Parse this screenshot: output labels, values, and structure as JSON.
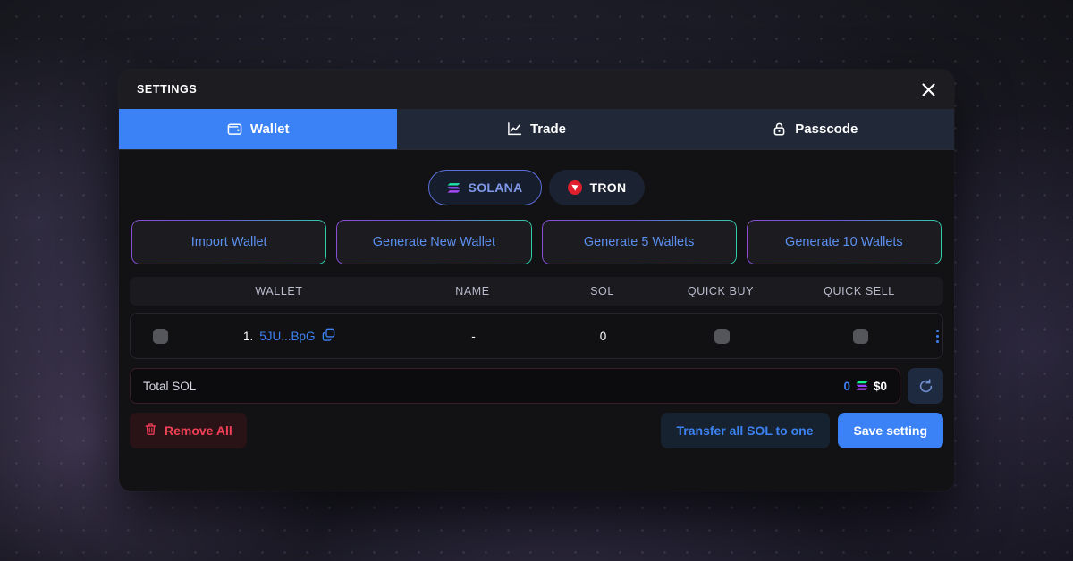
{
  "modal": {
    "title": "SETTINGS",
    "close_icon": "close-icon"
  },
  "tabs": [
    {
      "label": "Wallet",
      "icon": "wallet-icon",
      "active": true
    },
    {
      "label": "Trade",
      "icon": "line-chart-icon",
      "active": false
    },
    {
      "label": "Passcode",
      "icon": "lock-icon",
      "active": false
    }
  ],
  "chains": [
    {
      "label": "SOLANA",
      "icon": "solana-logo-icon",
      "selected": true
    },
    {
      "label": "TRON",
      "icon": "tron-logo-icon",
      "selected": false
    }
  ],
  "wallet_actions": [
    {
      "label": "Import Wallet"
    },
    {
      "label": "Generate New Wallet"
    },
    {
      "label": "Generate 5 Wallets"
    },
    {
      "label": "Generate 10 Wallets"
    }
  ],
  "table": {
    "headers": [
      "WALLET",
      "NAME",
      "SOL",
      "QUICK BUY",
      "QUICK SELL"
    ],
    "rows": [
      {
        "index": "1.",
        "address": "5JU...BpG",
        "name": "-",
        "sol": "0",
        "copy_icon": "copy-icon",
        "menu_icon": "more-vertical-icon"
      }
    ]
  },
  "total": {
    "label": "Total SOL",
    "sol_amount": "0",
    "usd_amount": "$0",
    "sol_icon": "solana-logo-icon",
    "refresh_icon": "refresh-icon"
  },
  "footer": {
    "remove_all_label": "Remove All",
    "remove_all_icon": "trash-icon",
    "transfer_label": "Transfer all SOL to one",
    "save_label": "Save setting"
  },
  "colors": {
    "accent_blue": "#3b82f6",
    "link_blue": "#3d82f2",
    "danger_red": "#ef4056",
    "solana_teal": "#14f195",
    "solana_purple": "#9945ff",
    "tron_red": "#e01f2d"
  }
}
